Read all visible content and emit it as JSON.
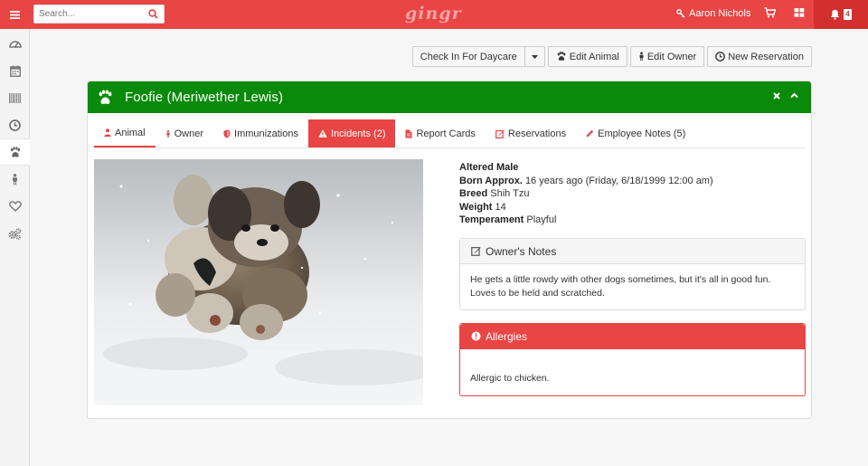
{
  "topbar": {
    "search_placeholder": "Search...",
    "logo": "gingr",
    "user_name": "Aaron Nichols",
    "notification_count": "4"
  },
  "colors": {
    "brand_red": "#e94545",
    "header_green": "#0a8a0a"
  },
  "sidebar": {
    "items": [
      {
        "icon": "dashboard-icon"
      },
      {
        "icon": "calendar-icon"
      },
      {
        "icon": "barcode-icon"
      },
      {
        "icon": "clock-icon"
      },
      {
        "icon": "paw-icon"
      },
      {
        "icon": "person-icon"
      },
      {
        "icon": "heart-icon"
      },
      {
        "icon": "gears-icon"
      }
    ]
  },
  "actions": {
    "check_in": "Check In For Daycare",
    "edit_animal": "Edit Animal",
    "edit_owner": "Edit Owner",
    "new_reservation": "New Reservation"
  },
  "animal": {
    "title": "Foofie (Meriwether Lewis)",
    "sex": "Altered Male",
    "born_label": "Born Approx.",
    "born_value": "16 years ago (Friday, 6/18/1999 12:00 am)",
    "breed_label": "Breed",
    "breed_value": "Shih Tzu",
    "weight_label": "Weight",
    "weight_value": "14",
    "temperament_label": "Temperament",
    "temperament_value": "Playful"
  },
  "tabs": [
    {
      "label": "Animal",
      "icon": "user-icon"
    },
    {
      "label": "Owner",
      "icon": "person-icon"
    },
    {
      "label": "Immunizations",
      "icon": "shield-icon"
    },
    {
      "label": "Incidents (2)",
      "icon": "warning-icon"
    },
    {
      "label": "Report Cards",
      "icon": "file-icon"
    },
    {
      "label": "Reservations",
      "icon": "edit-icon"
    },
    {
      "label": "Employee Notes (5)",
      "icon": "pencil-icon"
    }
  ],
  "owner_notes": {
    "title": "Owner's Notes",
    "body": "He gets a little rowdy with other dogs sometimes, but it's all in good fun.  Loves to be held and scratched."
  },
  "allergies": {
    "title": "Allergies",
    "body": "Allergic to chicken."
  }
}
